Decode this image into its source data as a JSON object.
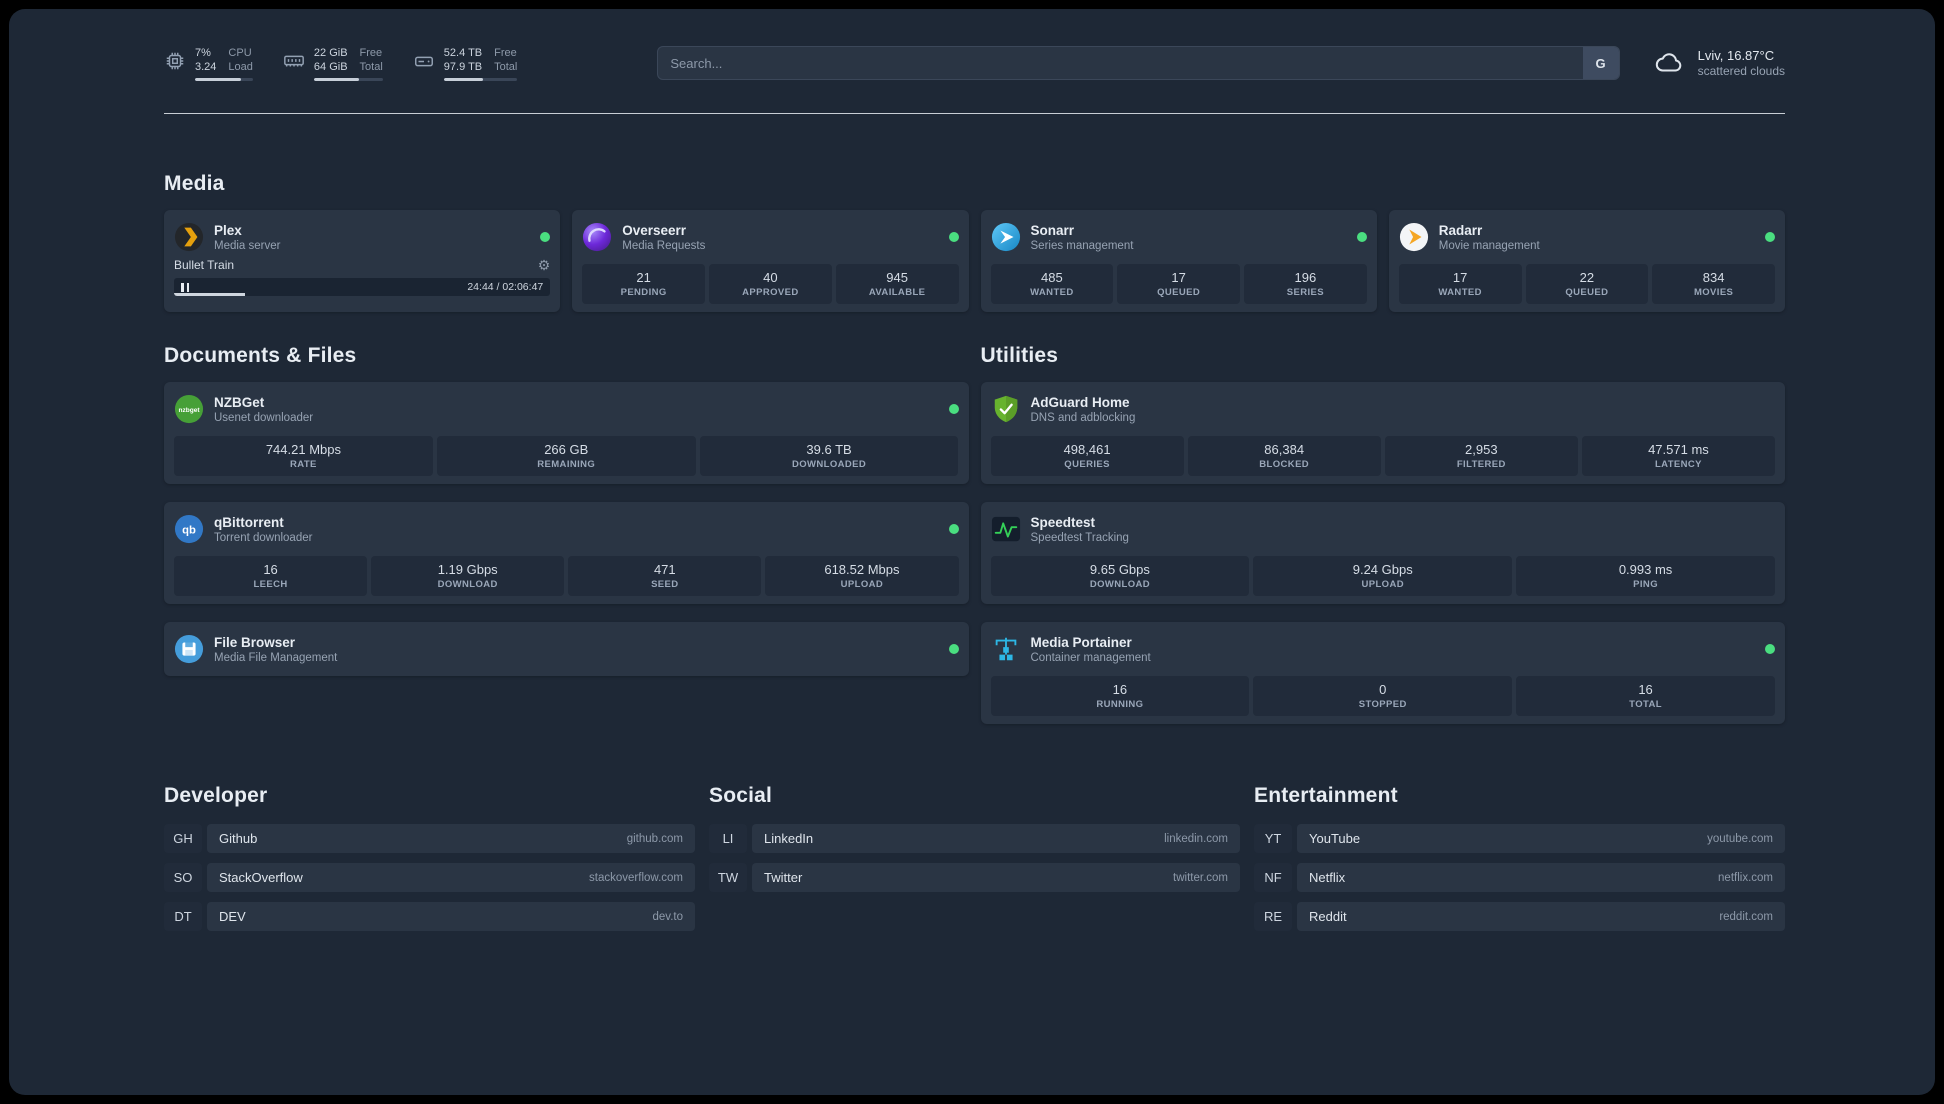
{
  "topbar": {
    "cpu": {
      "icon": "cpu-icon",
      "value_top": "7%",
      "value_bottom": "3.24",
      "label_top": "CPU",
      "label_bottom": "Load",
      "bar_percent": 80
    },
    "memory": {
      "icon": "memory-icon",
      "value_top": "22 GiB",
      "value_bottom": "64 GiB",
      "label_top": "Free",
      "label_bottom": "Total",
      "bar_percent": 66
    },
    "disk": {
      "icon": "disk-icon",
      "value_top": "52.4 TB",
      "value_bottom": "97.9 TB",
      "label_top": "Free",
      "label_bottom": "Total",
      "bar_percent": 53
    },
    "search": {
      "placeholder": "Search...",
      "provider_button": "G"
    },
    "weather": {
      "icon": "cloud-icon",
      "location": "Lviv, 16.87°C",
      "condition": "scattered clouds"
    }
  },
  "media": {
    "title": "Media",
    "cards": [
      {
        "name": "Plex",
        "desc": "Media server",
        "icon": "plex-icon",
        "status": "online",
        "player": {
          "track": "Bullet Train",
          "time": "24:44 / 02:06:47",
          "progress_percent": 19
        }
      },
      {
        "name": "Overseerr",
        "desc": "Media Requests",
        "icon": "overseerr-icon",
        "status": "online",
        "stats": [
          {
            "value": "21",
            "label": "PENDING"
          },
          {
            "value": "40",
            "label": "APPROVED"
          },
          {
            "value": "945",
            "label": "AVAILABLE"
          }
        ]
      },
      {
        "name": "Sonarr",
        "desc": "Series management",
        "icon": "sonarr-icon",
        "status": "online",
        "stats": [
          {
            "value": "485",
            "label": "WANTED"
          },
          {
            "value": "17",
            "label": "QUEUED"
          },
          {
            "value": "196",
            "label": "SERIES"
          }
        ]
      },
      {
        "name": "Radarr",
        "desc": "Movie management",
        "icon": "radarr-icon",
        "status": "online",
        "stats": [
          {
            "value": "17",
            "label": "WANTED"
          },
          {
            "value": "22",
            "label": "QUEUED"
          },
          {
            "value": "834",
            "label": "MOVIES"
          }
        ]
      }
    ]
  },
  "documents": {
    "title": "Documents & Files",
    "cards": [
      {
        "name": "NZBGet",
        "desc": "Usenet downloader",
        "icon": "nzbget-icon",
        "status": "online",
        "stats": [
          {
            "value": "744.21 Mbps",
            "label": "RATE"
          },
          {
            "value": "266 GB",
            "label": "REMAINING"
          },
          {
            "value": "39.6 TB",
            "label": "DOWNLOADED"
          }
        ]
      },
      {
        "name": "qBittorrent",
        "desc": "Torrent downloader",
        "icon": "qbittorrent-icon",
        "status": "online",
        "stats": [
          {
            "value": "16",
            "label": "LEECH"
          },
          {
            "value": "1.19 Gbps",
            "label": "DOWNLOAD"
          },
          {
            "value": "471",
            "label": "SEED"
          },
          {
            "value": "618.52 Mbps",
            "label": "UPLOAD"
          }
        ]
      },
      {
        "name": "File Browser",
        "desc": "Media File Management",
        "icon": "filebrowser-icon",
        "status": "online",
        "stats": []
      }
    ]
  },
  "utilities": {
    "title": "Utilities",
    "cards": [
      {
        "name": "AdGuard Home",
        "desc": "DNS and adblocking",
        "icon": "adguard-icon",
        "stats": [
          {
            "value": "498,461",
            "label": "QUERIES"
          },
          {
            "value": "86,384",
            "label": "BLOCKED"
          },
          {
            "value": "2,953",
            "label": "FILTERED"
          },
          {
            "value": "47.571 ms",
            "label": "LATENCY"
          }
        ]
      },
      {
        "name": "Speedtest",
        "desc": "Speedtest Tracking",
        "icon": "speedtest-icon",
        "stats": [
          {
            "value": "9.65 Gbps",
            "label": "DOWNLOAD"
          },
          {
            "value": "9.24 Gbps",
            "label": "UPLOAD"
          },
          {
            "value": "0.993 ms",
            "label": "PING"
          }
        ]
      },
      {
        "name": "Media Portainer",
        "desc": "Container management",
        "icon": "portainer-icon",
        "status": "online",
        "stats": [
          {
            "value": "16",
            "label": "RUNNING"
          },
          {
            "value": "0",
            "label": "STOPPED"
          },
          {
            "value": "16",
            "label": "TOTAL"
          }
        ]
      }
    ]
  },
  "bookmarks": [
    {
      "title": "Developer",
      "items": [
        {
          "abbr": "GH",
          "name": "Github",
          "url": "github.com"
        },
        {
          "abbr": "SO",
          "name": "StackOverflow",
          "url": "stackoverflow.com"
        },
        {
          "abbr": "DT",
          "name": "DEV",
          "url": "dev.to"
        }
      ]
    },
    {
      "title": "Social",
      "items": [
        {
          "abbr": "LI",
          "name": "LinkedIn",
          "url": "linkedin.com"
        },
        {
          "abbr": "TW",
          "name": "Twitter",
          "url": "twitter.com"
        }
      ]
    },
    {
      "title": "Entertainment",
      "items": [
        {
          "abbr": "YT",
          "name": "YouTube",
          "url": "youtube.com"
        },
        {
          "abbr": "NF",
          "name": "Netflix",
          "url": "netflix.com"
        },
        {
          "abbr": "RE",
          "name": "Reddit",
          "url": "reddit.com"
        }
      ]
    }
  ],
  "colors": {
    "page_bg": "#1e2836",
    "card_bg": "#2a3544",
    "stat_bg": "#212b3a",
    "status_online": "#4ade80",
    "plex_amber": "#e5a00d"
  }
}
